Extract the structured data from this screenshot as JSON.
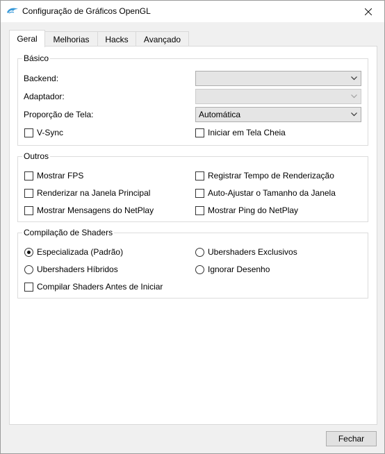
{
  "window": {
    "title": "Configuração de Gráficos OpenGL",
    "icon": "dolphin-icon",
    "accent_color": "#3a9ad9"
  },
  "tabs": [
    {
      "label": "Geral",
      "active": true
    },
    {
      "label": "Melhorias",
      "active": false
    },
    {
      "label": "Hacks",
      "active": false
    },
    {
      "label": "Avançado",
      "active": false
    }
  ],
  "basico": {
    "title": "Básico",
    "backend_label": "Backend:",
    "backend_value": "",
    "adaptador_label": "Adaptador:",
    "adaptador_value": "",
    "proporcao_label": "Proporção de Tela:",
    "proporcao_value": "Automática",
    "vsync": {
      "label": "V-Sync",
      "checked": false
    },
    "fullscreen": {
      "label": "Iniciar em Tela Cheia",
      "checked": false
    }
  },
  "outros": {
    "title": "Outros",
    "items": [
      {
        "label": "Mostrar FPS",
        "checked": false
      },
      {
        "label": "Registrar Tempo de Renderização",
        "checked": false
      },
      {
        "label": "Renderizar na Janela Principal",
        "checked": false
      },
      {
        "label": "Auto-Ajustar o Tamanho da Janela",
        "checked": false
      },
      {
        "label": "Mostrar Mensagens do NetPlay",
        "checked": false
      },
      {
        "label": "Mostrar Ping do NetPlay",
        "checked": false
      }
    ]
  },
  "shaders": {
    "title": "Compilação de Shaders",
    "radios": [
      {
        "label": "Especializada (Padrão)",
        "selected": true
      },
      {
        "label": "Ubershaders Exclusivos",
        "selected": false
      },
      {
        "label": "Ubershaders Híbridos",
        "selected": false
      },
      {
        "label": "Ignorar Desenho",
        "selected": false
      }
    ],
    "compile_before": {
      "label": "Compilar Shaders Antes de Iniciar",
      "checked": false
    }
  },
  "footer": {
    "close_label": "Fechar"
  }
}
